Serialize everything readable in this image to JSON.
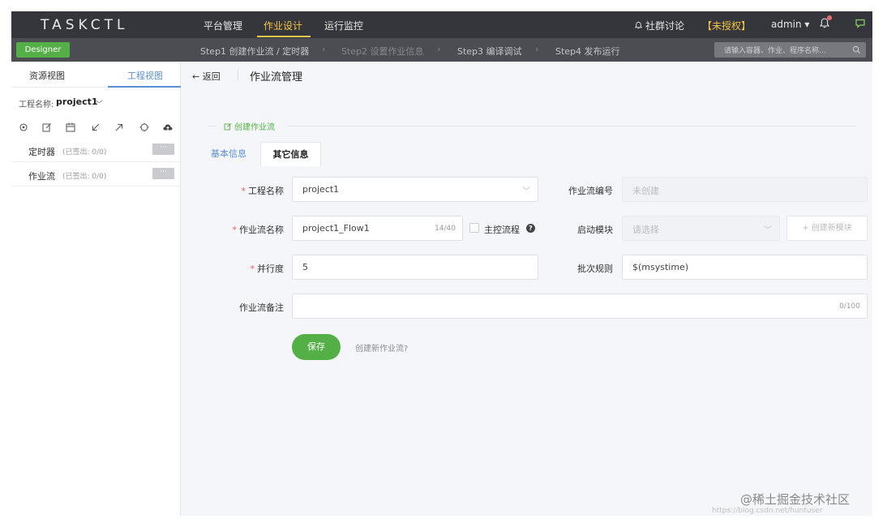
{
  "header": {
    "logo": "TASKCTL",
    "nav": [
      "平台管理",
      "作业设计",
      "运行监控"
    ],
    "community": "社群讨论",
    "license": "【未授权】",
    "user": "admin ▾"
  },
  "stepbar": {
    "designer": "Designer",
    "steps": [
      "Step1 创建作业流 / 定时器",
      "Step2 设置作业信息",
      "Step3 编译调试",
      "Step4 发布运行"
    ],
    "search_placeholder": "请输入容器、作业、程序名称..."
  },
  "sidebar": {
    "tabs": [
      "资源视图",
      "工程视图"
    ],
    "project_label": "工程名称:",
    "project_name": "project1",
    "items": [
      {
        "name": "定时器",
        "sub": "(已签出: 0/0)",
        "more": "···"
      },
      {
        "name": "作业流",
        "sub": "(已签出: 0/0)",
        "more": "···"
      }
    ]
  },
  "main": {
    "back": "← 返回",
    "title": "作业流管理",
    "section": "创建作业流",
    "tabs": [
      "基本信息",
      "其它信息"
    ],
    "form": {
      "project_label": "工程名称",
      "project_value": "project1",
      "flow_no_label": "作业流编号",
      "flow_no_placeholder": "未创建",
      "flow_name_label": "作业流名称",
      "flow_name_value": "project1_Flow1",
      "flow_name_count": "14/40",
      "main_flow_label": "主控流程",
      "start_module_label": "启动模块",
      "start_module_placeholder": "请选择",
      "new_module": "+ 创建新模块",
      "parallel_label": "并行度",
      "parallel_value": "5",
      "batch_label": "批次规则",
      "batch_value": "$(msystime)",
      "remark_label": "作业流备注",
      "remark_count": "0/100",
      "save": "保存",
      "create_new": "创建新作业流?"
    }
  },
  "watermark": {
    "text": "@稀土掘金技术社区",
    "url": "https://blog.csdn.net/huntuser"
  }
}
